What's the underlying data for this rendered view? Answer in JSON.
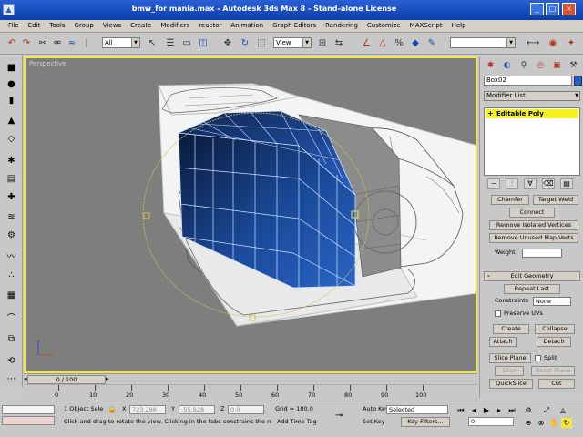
{
  "window": {
    "title": "bmw_for mania.max - Autodesk 3ds Max 8 - Stand-alone License",
    "app_icon": "3ds-max-icon",
    "min": "_",
    "max": "□",
    "close": "×"
  },
  "menu": {
    "items": [
      "File",
      "Edit",
      "Tools",
      "Group",
      "Views",
      "Create",
      "Modifiers",
      "reactor",
      "Animation",
      "Graph Editors",
      "Rendering",
      "Customize",
      "MAXScript",
      "Help"
    ]
  },
  "toolbar": {
    "selection_filter": "All",
    "coord_system": "View",
    "named_selection": ""
  },
  "viewport": {
    "label": "Perspective",
    "accent_color": "#f2e641"
  },
  "command_panel": {
    "object_name": "Box02",
    "object_color": "#1d5fd0",
    "modifier_list_label": "Modifier List",
    "stack_item": "Editable Poly",
    "stack_expand": "+",
    "buttons": {
      "chamfer": "Chamfer",
      "target_weld": "Target Weld",
      "connect": "Connect",
      "remove_isolated": "Remove Isolated Vertices",
      "remove_unused": "Remove Unused Map Verts",
      "repeat_last": "Repeat Last",
      "create": "Create",
      "collapse": "Collapse",
      "attach": "Attach",
      "detach": "Detach",
      "slice_plane": "Slice Plane",
      "split": "Split",
      "slice": "Slice",
      "reset_plane": "Reset Plane",
      "quickslice": "QuickSlice",
      "cut": "Cut"
    },
    "labels": {
      "weight": "Weight",
      "edit_geometry": "Edit Geometry",
      "constraints": "Constraints",
      "constraints_value": "None",
      "preserve_uvs": "Preserve UVs"
    }
  },
  "timeline": {
    "slider_label": "0 / 100",
    "ticks": [
      "0",
      "10",
      "20",
      "30",
      "40",
      "50",
      "60",
      "70",
      "80",
      "90",
      "100"
    ]
  },
  "status": {
    "selection": "1 Object Sele",
    "x_value": "723.298",
    "y_value": "-55.928",
    "z_value": "0.0",
    "grid": "Grid = 100.0",
    "prompt": "Click and drag to rotate the view.  Clicking in the tabs constrains the rotation",
    "add_time_tag": "Add Time Tag",
    "auto_key": "Auto Key",
    "selected": "Selected",
    "set_key": "Set Key",
    "key_filters": "Key Filters...",
    "frame": "0",
    "x_label": "X",
    "y_label": "Y",
    "z_label": "Z"
  }
}
